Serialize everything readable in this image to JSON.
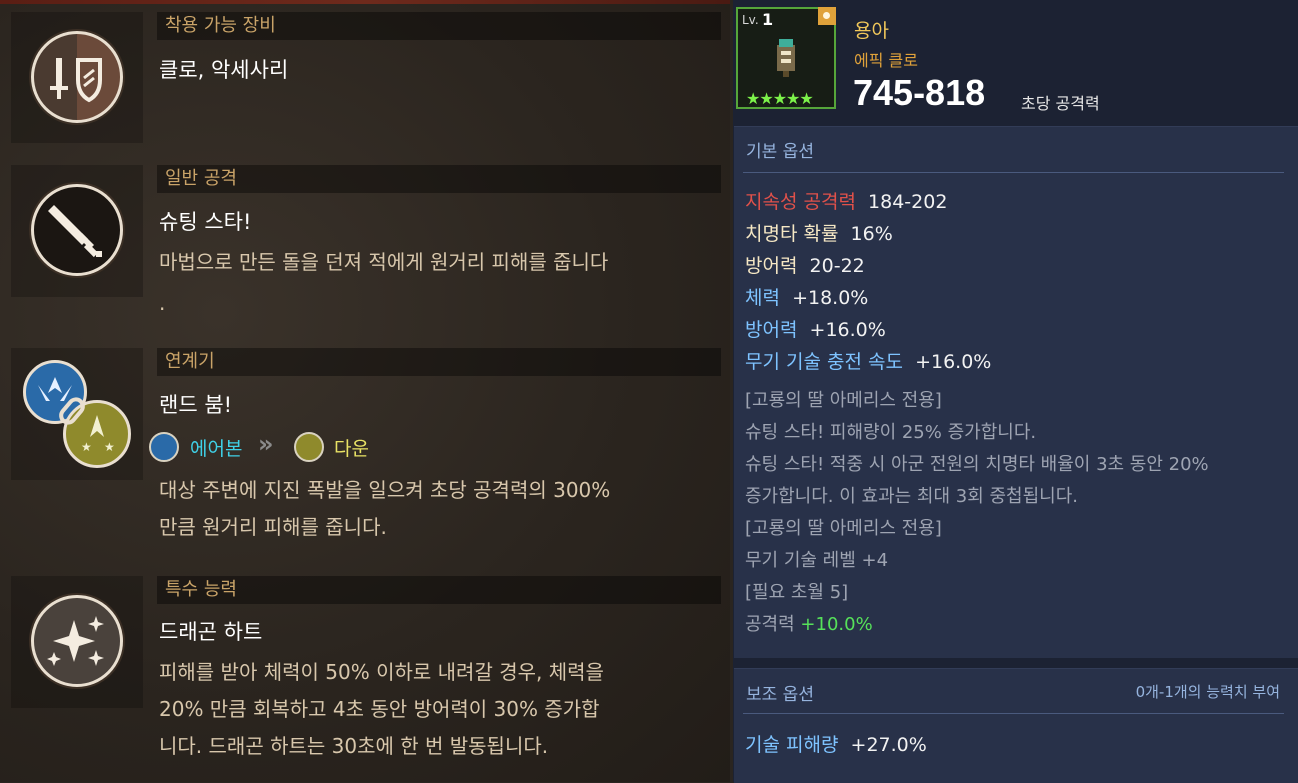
{
  "sections": {
    "equip": {
      "header": "착용 가능 장비",
      "title": "클로, 악세사리"
    },
    "attack": {
      "header": "일반 공격",
      "title": "슈팅 스타!",
      "desc": "마법으로 만든 돌을 던져 적에게 원거리 피해를 줍니다",
      "desc_tail": "."
    },
    "combo": {
      "header": "연계기",
      "title": "랜드 붐!",
      "skill1": "에어본",
      "arrow": "»",
      "skill2": "다운",
      "desc1": "대상 주변에 지진 폭발을 일으켜 초당 공격력의 300%",
      "desc2": "만큼 원거리 피해를 줍니다."
    },
    "special": {
      "header": "특수 능력",
      "title": "드래곤 하트",
      "desc1": "피해를 받아 체력이 50% 이하로 내려갈 경우, 체력을",
      "desc2": "20% 만큼 회복하고 4초 동안 방어력이 30% 증가합",
      "desc3": "니다. 드래곤 하트는 30초에 한 번 발동됩니다."
    }
  },
  "item": {
    "level_prefix": "Lv.",
    "level": "1",
    "stars": "★★★★★",
    "name": "용아",
    "type": "에픽 클로",
    "attack": "745-818",
    "attack_label": "초당 공격력"
  },
  "base_options": {
    "title": "기본 옵션",
    "stats": [
      {
        "label": "지속성 공격력",
        "value": "184-202"
      },
      {
        "label": "치명타 확률",
        "value": "16%"
      },
      {
        "label": "방어력",
        "value": "20-22"
      },
      {
        "label": "체력",
        "value": "+18.0%"
      },
      {
        "label": "방어력",
        "value": "+16.0%"
      },
      {
        "label": "무기 기술 충전 속도",
        "value": "+16.0%"
      }
    ],
    "notes": [
      "[고룡의 딸 아메리스 전용]",
      "슈팅 스타! 피해량이 25% 증가합니다.",
      "슈팅 스타! 적중 시 아군 전원의 치명타 배율이 3초 동안 20%",
      "증가합니다. 이 효과는 최대 3회 중첩됩니다.",
      "[고룡의 딸 아메리스 전용]",
      "무기 기술 레벨 +4",
      "[필요 초월 5]"
    ],
    "last_label": "공격력",
    "last_value": "+10.0%"
  },
  "sub_options": {
    "title": "보조 옵션",
    "range": "0개-1개의 능력치 부여",
    "stat_label": "기술 피해량",
    "stat_value": "+27.0%"
  },
  "colors": {
    "header_gold": "#c9a368",
    "stat_red": "#e0514a",
    "stat_cream": "#f5e7c4",
    "stat_blue": "#7ec3ff",
    "green": "#56e15a",
    "name_gold": "#f0c75a",
    "type_orange": "#e0a23a"
  }
}
